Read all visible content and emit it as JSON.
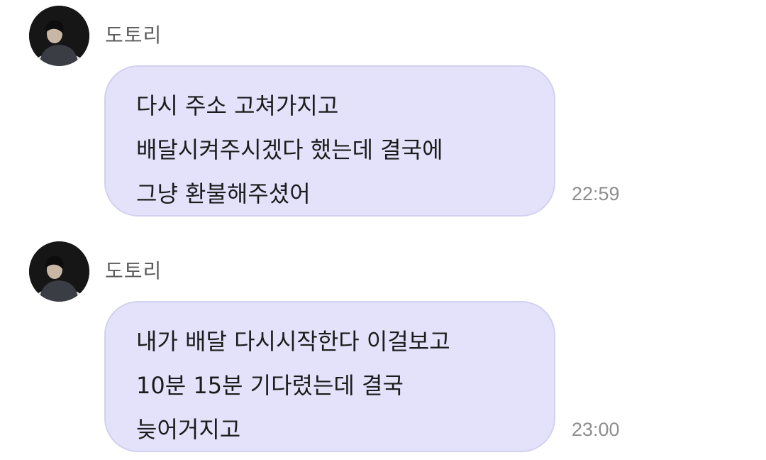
{
  "messages": [
    {
      "sender": "도토리",
      "lines": [
        "다시 주소 고쳐가지고",
        "배달시켜주시겠다 했는데 결국에",
        "그냥 환불해주셨어"
      ],
      "time": "22:59"
    },
    {
      "sender": "도토리",
      "lines": [
        "내가 배달 다시시작한다 이걸보고",
        "10분 15분 기다렸는데 결국",
        "늦어거지고"
      ],
      "time": "23:00"
    }
  ],
  "colors": {
    "bubble": "#e4e2fb",
    "bubble_border": "#d3d0f0",
    "sender": "#5a5a5a",
    "time": "#8e8e8e"
  }
}
